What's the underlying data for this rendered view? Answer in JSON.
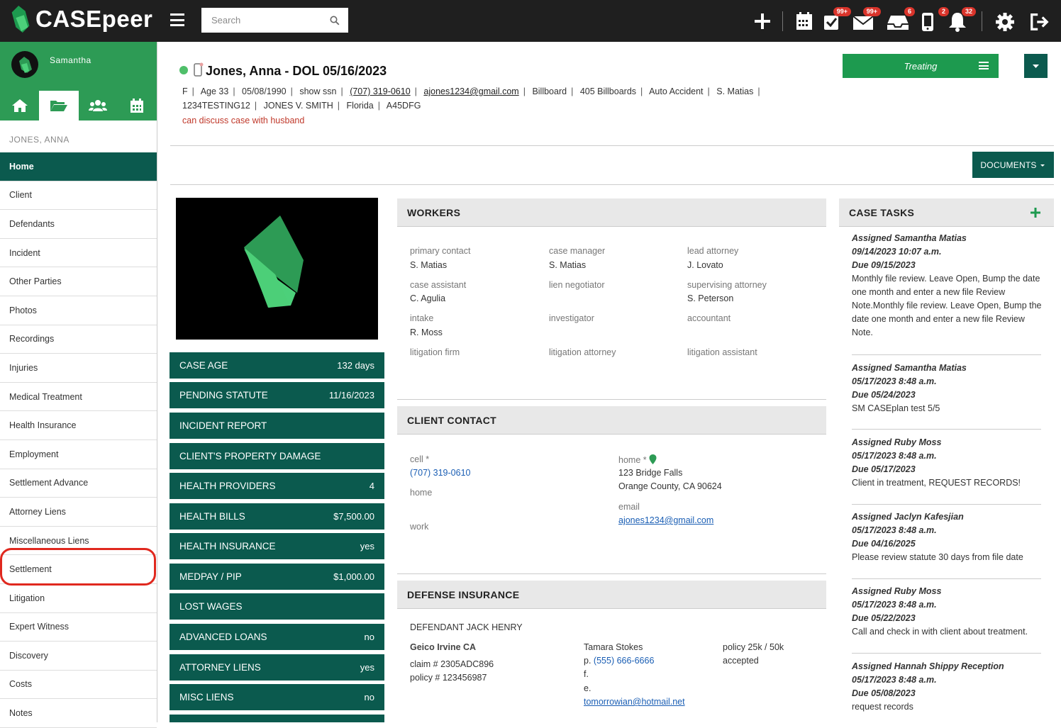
{
  "app": {
    "name": "CASEpeer"
  },
  "search": {
    "placeholder": "Search"
  },
  "topbar": {
    "badges": {
      "tasks": "99+",
      "mail": "99+",
      "inbox": "6",
      "phone": "2",
      "notifications": "32"
    }
  },
  "sidebar": {
    "user": "Samantha",
    "case_name": "JONES, ANNA",
    "items": [
      {
        "label": "Home"
      },
      {
        "label": "Client"
      },
      {
        "label": "Defendants"
      },
      {
        "label": "Incident"
      },
      {
        "label": "Other Parties"
      },
      {
        "label": "Photos"
      },
      {
        "label": "Recordings"
      },
      {
        "label": "Injuries"
      },
      {
        "label": "Medical Treatment"
      },
      {
        "label": "Health Insurance"
      },
      {
        "label": "Employment"
      },
      {
        "label": "Settlement Advance"
      },
      {
        "label": "Attorney Liens"
      },
      {
        "label": "Miscellaneous Liens"
      },
      {
        "label": "Settlement"
      },
      {
        "label": "Litigation"
      },
      {
        "label": "Expert Witness"
      },
      {
        "label": "Discovery"
      },
      {
        "label": "Costs"
      },
      {
        "label": "Notes"
      }
    ]
  },
  "header": {
    "title": "Jones, Anna - DOL 05/16/2023",
    "info": [
      "F",
      "Age 33",
      "05/08/1990",
      "show ssn",
      "(707) 319-0610",
      "ajones1234@gmail.com",
      "Billboard",
      "405 Billboards",
      "Auto Accident",
      "S. Matias",
      "1234TESTING12",
      "JONES V. SMITH",
      "Florida",
      "A45DFG"
    ],
    "note": "can discuss case with husband",
    "status": "Treating",
    "documents_label": "DOCUMENTS"
  },
  "stats": [
    {
      "label": "CASE AGE",
      "value": "132 days"
    },
    {
      "label": "PENDING STATUTE",
      "value": "11/16/2023"
    },
    {
      "label": "INCIDENT REPORT",
      "value": ""
    },
    {
      "label": "CLIENT'S PROPERTY DAMAGE",
      "value": ""
    },
    {
      "label": "HEALTH PROVIDERS",
      "value": "4"
    },
    {
      "label": "HEALTH BILLS",
      "value": "$7,500.00"
    },
    {
      "label": "HEALTH INSURANCE",
      "value": "yes"
    },
    {
      "label": "MEDPAY / PIP",
      "value": "$1,000.00"
    },
    {
      "label": "LOST WAGES",
      "value": ""
    },
    {
      "label": "ADVANCED LOANS",
      "value": "no"
    },
    {
      "label": "ATTORNEY LIENS",
      "value": "yes"
    },
    {
      "label": "MISC LIENS",
      "value": "no"
    }
  ],
  "workers": {
    "title": "WORKERS",
    "items": [
      {
        "role": "primary contact",
        "name": "S. Matias"
      },
      {
        "role": "case manager",
        "name": "S. Matias"
      },
      {
        "role": "lead attorney",
        "name": "J. Lovato"
      },
      {
        "role": "case assistant",
        "name": "C. Agulia"
      },
      {
        "role": "lien negotiator",
        "name": ""
      },
      {
        "role": "supervising attorney",
        "name": "S. Peterson"
      },
      {
        "role": "intake",
        "name": "R. Moss"
      },
      {
        "role": "investigator",
        "name": ""
      },
      {
        "role": "accountant",
        "name": ""
      },
      {
        "role": "litigation firm",
        "name": ""
      },
      {
        "role": "litigation attorney",
        "name": ""
      },
      {
        "role": "litigation assistant",
        "name": ""
      }
    ]
  },
  "client_contact": {
    "title": "CLIENT CONTACT",
    "cell_label": "cell *",
    "cell": "(707) 319-0610",
    "home_phone_label": "home",
    "work_label": "work",
    "home_label": "home *",
    "address1": "123 Bridge Falls",
    "address2": "Orange County, CA 90624",
    "email_label": "email",
    "email": "ajones1234@gmail.com"
  },
  "defense_insurance": {
    "title": "DEFENSE INSURANCE",
    "defendant": "DEFENDANT JACK HENRY",
    "company": "Geico Irvine CA",
    "claim": "claim # 2305ADC896",
    "policy_no": "policy # 123456987",
    "adjuster": "Tamara Stokes",
    "phone_prefix": "p.",
    "phone": "(555) 666-6666",
    "fax": "f.",
    "email_prefix": "e.",
    "email": "tomorrowian@hotmail.net",
    "policy_limits": "policy 25k / 50k",
    "policy_status": "accepted"
  },
  "case_tasks": {
    "title": "CASE TASKS",
    "items": [
      {
        "assigned": "Assigned Samantha Matias",
        "created": "09/14/2023 10:07 a.m.",
        "due": "Due 09/15/2023",
        "text": "Monthly file review. Leave Open, Bump the date one month and enter a new file Review Note.Monthly file review. Leave Open, Bump the date one month and enter a new file Review Note."
      },
      {
        "assigned": "Assigned Samantha Matias",
        "created": "05/17/2023 8:48 a.m.",
        "due": "Due 05/24/2023",
        "text": "SM CASEplan test 5/5"
      },
      {
        "assigned": "Assigned Ruby Moss",
        "created": "05/17/2023 8:48 a.m.",
        "due": "Due 05/17/2023",
        "text": "Client in treatment, REQUEST RECORDS!"
      },
      {
        "assigned": "Assigned Jaclyn Kafesjian",
        "created": "05/17/2023 8:48 a.m.",
        "due": "Due 04/16/2025",
        "text": "Please review statute 30 days from file date"
      },
      {
        "assigned": "Assigned Ruby Moss",
        "created": "05/17/2023 8:48 a.m.",
        "due": "Due 05/22/2023",
        "text": "Call and check in with client about treatment."
      },
      {
        "assigned": "Assigned Hannah Shippy Reception",
        "created": "05/17/2023 8:48 a.m.",
        "due": "Due 05/08/2023",
        "text": "request records"
      }
    ]
  },
  "colors": {
    "brand_green": "#2d9b55",
    "dark_teal": "#0b5a4e",
    "topbar": "#1f1f1f",
    "highlight_ring": "#e0281e",
    "status_dot": "#4fbf6a"
  }
}
